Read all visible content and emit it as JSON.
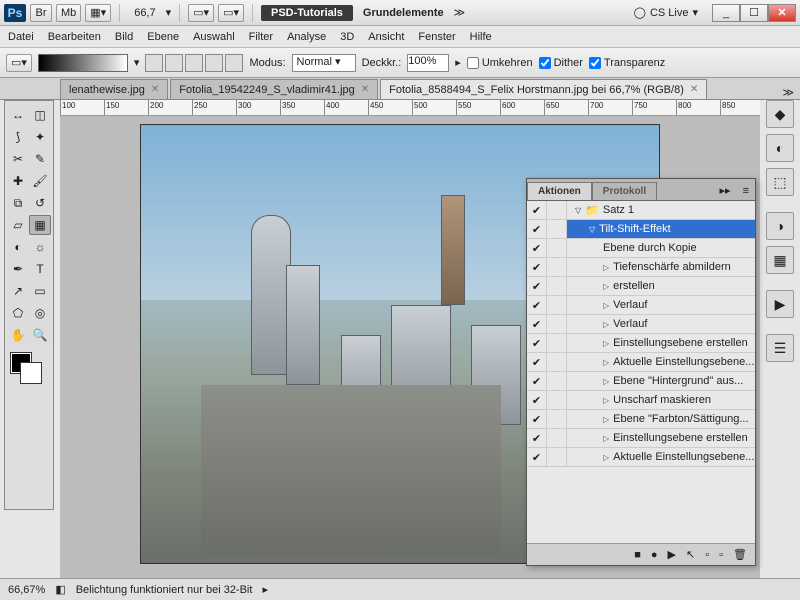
{
  "titlebar": {
    "ps": "Ps",
    "br": "Br",
    "mb": "Mb",
    "zoom": "66,7",
    "psd_tut": "PSD-Tutorials",
    "grund": "Grundelemente",
    "cslive": "CS Live"
  },
  "menubar": [
    "Datei",
    "Bearbeiten",
    "Bild",
    "Ebene",
    "Auswahl",
    "Filter",
    "Analyse",
    "3D",
    "Ansicht",
    "Fenster",
    "Hilfe"
  ],
  "optbar": {
    "modus_label": "Modus:",
    "modus_value": "Normal",
    "deckkr_label": "Deckkr.:",
    "deckkr_value": "100%",
    "umkehren": "Umkehren",
    "dither": "Dither",
    "transparenz": "Transparenz"
  },
  "tabs": [
    {
      "label": "lenathewise.jpg",
      "active": false
    },
    {
      "label": "Fotolia_19542249_S_vladimir41.jpg",
      "active": false
    },
    {
      "label": "Fotolia_8588494_S_Felix Horstmann.jpg bei 66,7% (RGB/8)",
      "active": true
    }
  ],
  "ruler_ticks": [
    100,
    150,
    200,
    250,
    300,
    350,
    400,
    450,
    500,
    550,
    600,
    650,
    700,
    750,
    800,
    850
  ],
  "actions": {
    "tab1": "Aktionen",
    "tab2": "Protokoll",
    "set_name": "Satz 1",
    "effect_name": "Tilt-Shift-Effekt",
    "steps": [
      "Ebene durch Kopie",
      "Tiefenschärfe abmildern",
      "erstellen",
      "Verlauf",
      "Verlauf",
      "Einstellungsebene erstellen",
      "Aktuelle Einstellungsebene...",
      "Ebene \"Hintergrund\" aus...",
      "Unscharf maskieren",
      "Ebene \"Farbton/Sättigung...",
      "Einstellungsebene erstellen",
      "Aktuelle Einstellungsebene..."
    ]
  },
  "statusbar": {
    "zoom": "66,67%",
    "msg": "Belichtung funktioniert nur bei 32-Bit"
  }
}
